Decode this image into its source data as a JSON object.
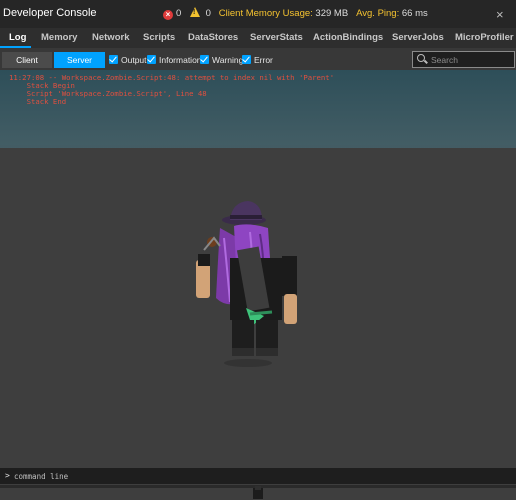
{
  "window": {
    "title": "Developer Console",
    "close_glyph": "×"
  },
  "stats": {
    "error_count": "0",
    "warning_count": "0",
    "memory_label": "Client Memory Usage:",
    "memory_value": "329 MB",
    "ping_label": "Avg. Ping:",
    "ping_value": "66 ms"
  },
  "tabs": [
    {
      "label": "Log",
      "active": true
    },
    {
      "label": "Memory"
    },
    {
      "label": "Network"
    },
    {
      "label": "Scripts"
    },
    {
      "label": "DataStores"
    },
    {
      "label": "ServerStats"
    },
    {
      "label": "ActionBindings"
    },
    {
      "label": "ServerJobs"
    },
    {
      "label": "MicroProfiler"
    }
  ],
  "filters": {
    "client_label": "Client",
    "server_label": "Server",
    "output_label": "Output",
    "information_label": "Information",
    "warning_label": "Warning",
    "error_label": "Error",
    "search_placeholder": "Search"
  },
  "log": [
    "11:27:08 -- Workspace.Zombie.Script:48: attempt to index nil with 'Parent'",
    "    Stack Begin",
    "    Script 'Workspace.Zombie.Script', Line 48",
    "    Stack End"
  ],
  "command": {
    "prompt": ">",
    "placeholder": "command line"
  },
  "colors": {
    "accent": "#00a2ff",
    "error_text": "#e0503f",
    "memory_text": "#f5c330",
    "titlebar": "#262626"
  }
}
